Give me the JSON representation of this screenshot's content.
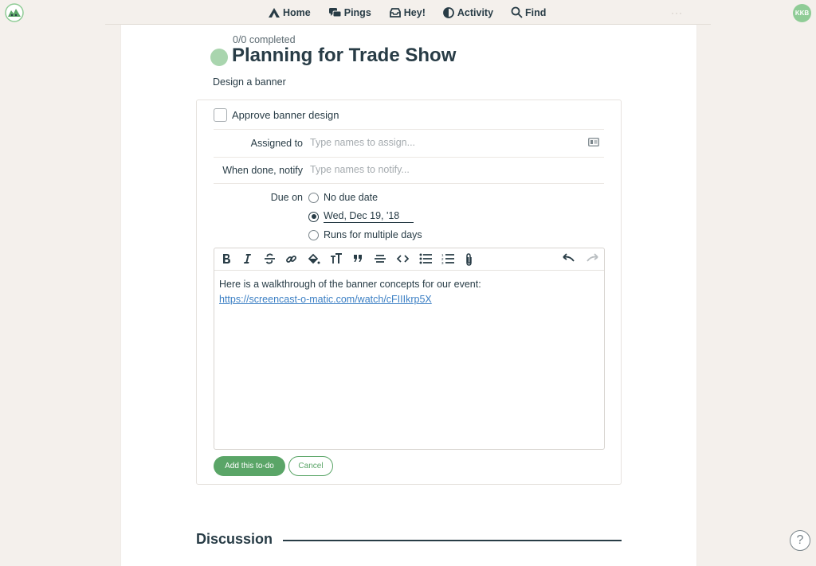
{
  "nav": {
    "items": [
      {
        "label": "Home",
        "icon": "home-icon"
      },
      {
        "label": "Pings",
        "icon": "pings-icon"
      },
      {
        "label": "Hey!",
        "icon": "hey-icon"
      },
      {
        "label": "Activity",
        "icon": "activity-icon"
      },
      {
        "label": "Find",
        "icon": "search-icon"
      }
    ],
    "more": "···",
    "avatar_initials": "KKB"
  },
  "todolist": {
    "progress": "0/0 completed",
    "title": "Planning for Trade Show",
    "description": "Design a banner"
  },
  "todo": {
    "title": "Approve banner design",
    "assigned_label": "Assigned to",
    "assigned_placeholder": "Type names to assign...",
    "notify_label": "When done, notify",
    "notify_placeholder": "Type names to notify...",
    "due_label": "Due on",
    "due_options": [
      "No due date",
      "Wed, Dec 19, '18",
      "Runs for multiple days"
    ],
    "due_selected": "Wed, Dec 19, '18"
  },
  "editor": {
    "toolbar": [
      "bold-icon",
      "italic-icon",
      "strikethrough-icon",
      "link-icon",
      "highlight-icon",
      "text-size-icon",
      "quote-icon",
      "divider-icon",
      "code-icon",
      "bullet-list-icon",
      "numbered-list-icon",
      "attachment-icon",
      "undo-icon",
      "redo-icon"
    ],
    "body_text": "Here is a walkthrough of the banner concepts for our event:",
    "body_link": "https://screencast-o-matic.com/watch/cFIIIkrp5X"
  },
  "actions": {
    "add": "Add this to-do",
    "cancel": "Cancel"
  },
  "discussion": {
    "title": "Discussion"
  },
  "help": "?",
  "colors": {
    "accent": "#5aa567",
    "text": "#283c46",
    "link": "#3b7fc4",
    "background": "#f4f0ec"
  }
}
